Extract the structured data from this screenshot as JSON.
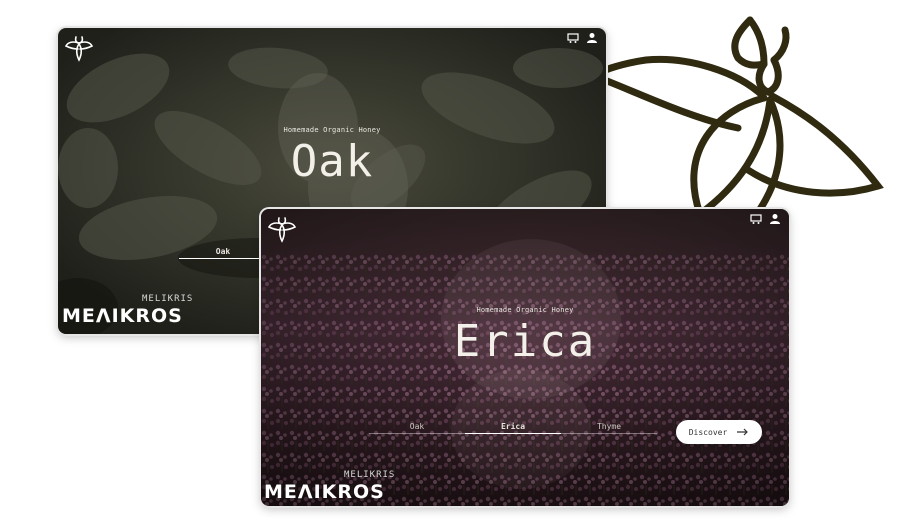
{
  "colors": {
    "bee_outline": "#2f2a10",
    "oak_background": "#2f2f28",
    "erica_background": "#3b2a30",
    "text": "#f3f0ea",
    "button_bg": "#ffffff"
  },
  "oak_card": {
    "subtitle": "Homemade Organic Honey",
    "title": "Oak",
    "tabs": [
      {
        "label": "Oak",
        "active": true
      }
    ],
    "brand_small": "MELIKRIS",
    "brand_small_prefix": "",
    "brand_large": "MEΛIKROS",
    "icons": [
      "bee-logo-icon",
      "cart-icon",
      "user-icon"
    ]
  },
  "erica_card": {
    "subtitle": "Homemade Organic Honey",
    "title": "Erica",
    "tabs": [
      {
        "label": "Oak",
        "active": false
      },
      {
        "label": "Erica",
        "active": true
      },
      {
        "label": "Thyme",
        "active": false
      }
    ],
    "discover_label": "Discover",
    "brand_small": "MELIKRIS",
    "brand_small_prefix": "",
    "brand_large": "MEΛIKROS",
    "icons": [
      "bee-logo-icon",
      "cart-icon",
      "user-icon",
      "arrow-right-icon"
    ]
  }
}
